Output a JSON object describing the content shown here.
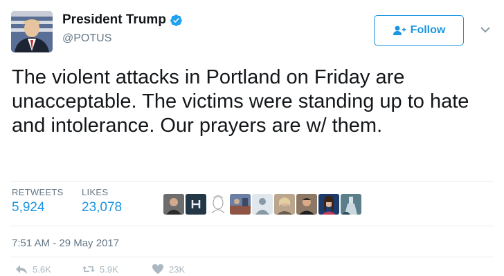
{
  "user": {
    "display_name": "President Trump",
    "handle": "@POTUS",
    "verified": true,
    "avatar_icon": "user-avatar-portrait"
  },
  "follow_button": {
    "label": "Follow",
    "icon": "add-user-icon"
  },
  "tweet": {
    "text": "The violent attacks in Portland on Friday are unacceptable. The victims were standing up to hate and intolerance. Our prayers are w/ them."
  },
  "stats": {
    "retweets_label": "RETWEETS",
    "retweets_value": "5,924",
    "likes_label": "LIKES",
    "likes_value": "23,078"
  },
  "liked_by_count": 9,
  "timestamp": "7:51 AM - 29 May 2017",
  "actions": {
    "reply_count": "5.6K",
    "retweet_count": "5.9K",
    "like_count": "23K"
  },
  "colors": {
    "accent": "#1b95e0",
    "muted": "#657786",
    "action_icon": "#aab8c2",
    "divider": "#e6ecf0"
  }
}
